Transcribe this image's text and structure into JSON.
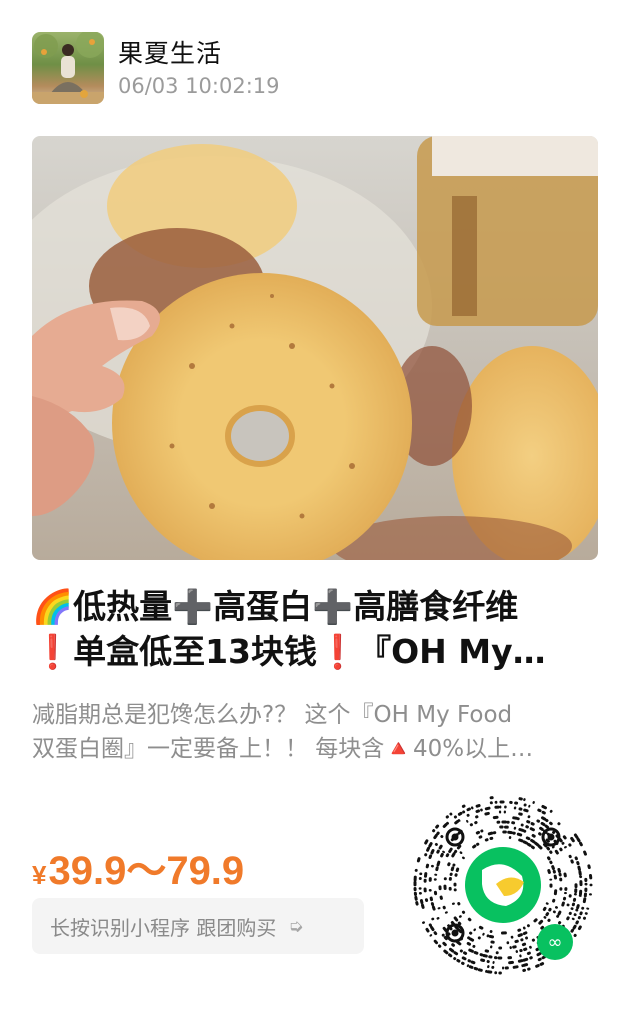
{
  "post": {
    "author": "果夏生活",
    "timestamp": "06/03 10:02:19"
  },
  "product": {
    "title_line1": "🌈低热量➕高蛋白➕高膳食纤维",
    "title_line2": "❗单盒低至13块钱❗『OH My…",
    "desc_line1": "减脂期总是犯馋怎么办?？ 这个『OH My Food",
    "desc_line2": "双蛋白圈』一定要备上！！ 每块含🔺40%以上…",
    "currency": "¥",
    "price_range": "39.9～79.9"
  },
  "action": {
    "buy_label": "长按识别小程序 跟团购买",
    "arrow_icon": "pointer-arrow-icon"
  },
  "colors": {
    "price": "#f07a2a",
    "qr_logo_green": "#08c160",
    "qr_logo_yellow": "#f7cb2e"
  }
}
